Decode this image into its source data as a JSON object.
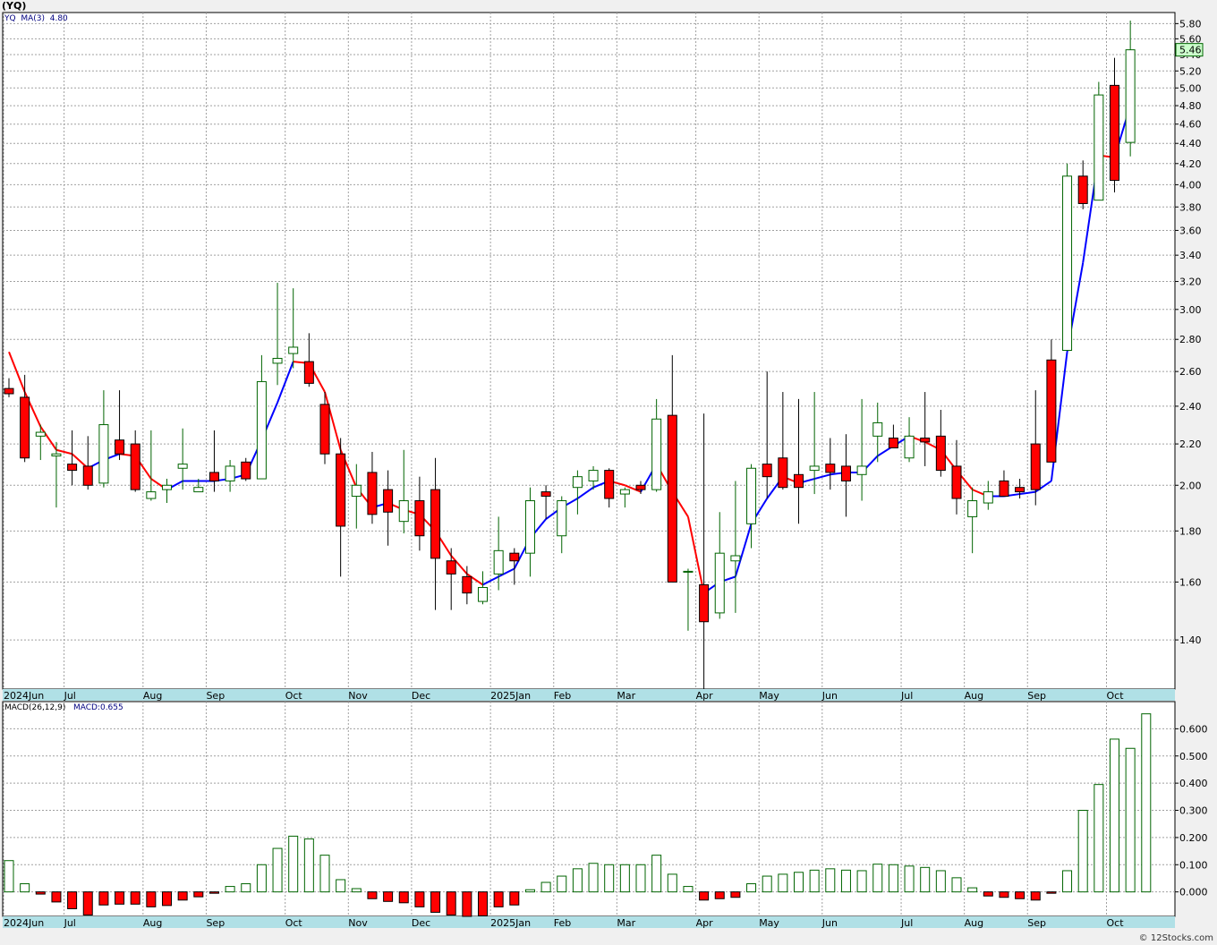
{
  "title": "(YQ)",
  "legend": {
    "ticker": "YQ",
    "ma_label": "MA(3)",
    "ma_value": "4.80",
    "macd_label": "MACD(26,12,9)",
    "macd_value": "MACD:0.655"
  },
  "watermark": "© 12Stocks.com",
  "colors": {
    "up": "#006400",
    "down": "#ff0000",
    "ma_up": "#0000ff",
    "ma_down": "#ff0000",
    "grid": "#a0a0a0",
    "axis_bar": "#b0e0e6",
    "price_tag": "#ccffcc"
  },
  "chart_data": [
    {
      "type": "candlestick",
      "scale": "log",
      "ylim": [
        1.25,
        5.95
      ],
      "yticks": [
        1.4,
        1.6,
        1.8,
        2.0,
        2.2,
        2.4,
        2.6,
        2.8,
        3.0,
        3.2,
        3.4,
        3.6,
        3.8,
        4.0,
        4.2,
        4.4,
        4.6,
        4.8,
        5.0,
        5.2,
        5.4,
        5.6,
        5.8
      ],
      "ytick_labels": [
        "1.40",
        "1.60",
        "1.80",
        "2.00",
        "2.20",
        "2.40",
        "2.60",
        "2.80",
        "3.00",
        "3.20",
        "3.40",
        "3.60",
        "3.80",
        "4.00",
        "4.20",
        "4.40",
        "4.60",
        "4.80",
        "5.00",
        "5.20",
        "5.40",
        "5.60",
        "5.80"
      ],
      "last_price": "5.46",
      "x_labels": [
        "2024Jun",
        "Jul",
        "Aug",
        "Sep",
        "Oct",
        "Nov",
        "Dec",
        "2025Jan",
        "Feb",
        "Mar",
        "Apr",
        "May",
        "Jun",
        "Jul",
        "Aug",
        "Sep",
        "Oct"
      ],
      "x_label_week": [
        0,
        4,
        9,
        13,
        18,
        22,
        26,
        31,
        35,
        39,
        44,
        48,
        52,
        57,
        61,
        65,
        70
      ],
      "weeks_ohlc": [
        [
          2.5,
          2.56,
          2.45,
          2.47
        ],
        [
          2.45,
          2.58,
          2.11,
          2.13
        ],
        [
          2.24,
          2.3,
          2.12,
          2.26
        ],
        [
          2.14,
          2.21,
          1.9,
          2.15
        ],
        [
          2.1,
          2.27,
          2.0,
          2.07
        ],
        [
          2.09,
          2.24,
          1.98,
          2.0
        ],
        [
          2.01,
          2.49,
          1.99,
          2.3
        ],
        [
          2.22,
          2.49,
          2.12,
          2.15
        ],
        [
          2.2,
          2.27,
          1.97,
          1.98
        ],
        [
          1.94,
          2.27,
          1.93,
          1.97
        ],
        [
          1.98,
          2.03,
          1.92,
          2.0
        ],
        [
          2.08,
          2.28,
          1.98,
          2.1
        ],
        [
          1.97,
          2.03,
          1.97,
          1.99
        ],
        [
          2.06,
          2.27,
          1.97,
          2.02
        ],
        [
          2.02,
          2.12,
          1.97,
          2.09
        ],
        [
          2.11,
          2.13,
          2.02,
          2.03
        ],
        [
          2.03,
          2.7,
          2.03,
          2.54
        ],
        [
          2.65,
          3.19,
          2.52,
          2.68
        ],
        [
          2.71,
          3.15,
          2.62,
          2.75
        ],
        [
          2.66,
          2.84,
          2.51,
          2.53
        ],
        [
          2.41,
          2.48,
          2.1,
          2.15
        ],
        [
          2.15,
          2.23,
          1.62,
          1.82
        ],
        [
          1.95,
          2.1,
          1.81,
          2.0
        ],
        [
          2.06,
          2.16,
          1.83,
          1.87
        ],
        [
          1.98,
          2.07,
          1.74,
          1.88
        ],
        [
          1.84,
          2.17,
          1.79,
          1.93
        ],
        [
          1.93,
          2.04,
          1.72,
          1.78
        ],
        [
          1.98,
          2.13,
          1.5,
          1.69
        ],
        [
          1.68,
          1.73,
          1.5,
          1.63
        ],
        [
          1.62,
          1.66,
          1.52,
          1.56
        ],
        [
          1.53,
          1.64,
          1.52,
          1.58
        ],
        [
          1.63,
          1.86,
          1.57,
          1.72
        ],
        [
          1.71,
          1.73,
          1.59,
          1.68
        ],
        [
          1.71,
          1.99,
          1.62,
          1.93
        ],
        [
          1.97,
          2.0,
          1.85,
          1.95
        ],
        [
          1.78,
          1.95,
          1.71,
          1.93
        ],
        [
          1.99,
          2.07,
          1.87,
          2.04
        ],
        [
          2.02,
          2.09,
          1.98,
          2.07
        ],
        [
          2.07,
          2.08,
          1.9,
          1.94
        ],
        [
          1.96,
          1.99,
          1.9,
          1.98
        ],
        [
          2.0,
          2.02,
          1.96,
          1.98
        ],
        [
          1.98,
          2.44,
          1.97,
          2.33
        ],
        [
          2.35,
          2.7,
          1.6,
          1.6
        ],
        [
          1.64,
          1.65,
          1.43,
          1.64
        ],
        [
          1.59,
          2.36,
          1.25,
          1.46
        ],
        [
          1.49,
          1.88,
          1.47,
          1.71
        ],
        [
          1.68,
          2.02,
          1.49,
          1.7
        ],
        [
          1.83,
          2.1,
          1.73,
          2.08
        ],
        [
          2.1,
          2.6,
          1.94,
          2.04
        ],
        [
          2.13,
          2.48,
          1.98,
          1.99
        ],
        [
          2.05,
          2.44,
          1.83,
          1.99
        ],
        [
          2.07,
          2.48,
          1.96,
          2.09
        ],
        [
          2.1,
          2.23,
          1.98,
          2.06
        ],
        [
          2.09,
          2.25,
          1.86,
          2.02
        ],
        [
          2.05,
          2.44,
          1.93,
          2.09
        ],
        [
          2.24,
          2.42,
          2.11,
          2.31
        ],
        [
          2.23,
          2.3,
          2.2,
          2.18
        ],
        [
          2.13,
          2.34,
          2.11,
          2.24
        ],
        [
          2.23,
          2.48,
          2.09,
          2.21
        ],
        [
          2.24,
          2.38,
          2.04,
          2.07
        ],
        [
          2.09,
          2.22,
          1.87,
          1.94
        ],
        [
          1.86,
          1.99,
          1.71,
          1.93
        ],
        [
          1.92,
          2.02,
          1.89,
          1.97
        ],
        [
          2.02,
          2.07,
          1.95,
          1.95
        ],
        [
          1.99,
          2.03,
          1.94,
          1.97
        ],
        [
          2.2,
          2.49,
          1.91,
          1.98
        ],
        [
          2.67,
          2.8,
          2.11,
          2.11
        ],
        [
          2.73,
          4.2,
          2.73,
          4.08
        ],
        [
          4.08,
          4.23,
          3.78,
          3.83
        ],
        [
          3.86,
          5.07,
          3.86,
          4.92
        ],
        [
          5.03,
          5.36,
          3.93,
          4.04
        ],
        [
          4.41,
          5.84,
          4.27,
          5.46
        ]
      ],
      "ma3": [
        2.72,
        2.48,
        2.29,
        2.17,
        2.15,
        2.08,
        2.12,
        2.15,
        2.14,
        2.03,
        1.98,
        2.02,
        2.02,
        2.02,
        2.03,
        2.05,
        2.22,
        2.42,
        2.66,
        2.65,
        2.48,
        2.17,
        1.99,
        1.9,
        1.92,
        1.89,
        1.87,
        1.8,
        1.7,
        1.63,
        1.59,
        1.62,
        1.65,
        1.77,
        1.85,
        1.9,
        1.94,
        1.99,
        2.02,
        2.0,
        1.97,
        2.1,
        1.97,
        1.86,
        1.56,
        1.6,
        1.62,
        1.83,
        1.94,
        2.04,
        2.01,
        2.03,
        2.05,
        2.06,
        2.06,
        2.14,
        2.19,
        2.24,
        2.21,
        2.17,
        2.07,
        1.98,
        1.95,
        1.95,
        1.96,
        1.97,
        2.02,
        2.72,
        3.34,
        4.28,
        4.26,
        4.8
      ]
    },
    {
      "type": "bar",
      "title": "MACD(26,12,9)",
      "ylim": [
        -0.09,
        0.7
      ],
      "yticks": [
        0.0,
        0.1,
        0.2,
        0.3,
        0.4,
        0.5,
        0.6
      ],
      "ytick_labels": [
        "0.000",
        "0.100",
        "0.200",
        "0.300",
        "0.400",
        "0.500",
        "0.600"
      ],
      "values": [
        0.115,
        0.03,
        -0.008,
        -0.037,
        -0.062,
        -0.085,
        -0.048,
        -0.045,
        -0.045,
        -0.055,
        -0.05,
        -0.03,
        -0.018,
        -0.005,
        0.02,
        0.03,
        0.1,
        0.16,
        0.205,
        0.195,
        0.135,
        0.045,
        0.012,
        -0.025,
        -0.035,
        -0.04,
        -0.055,
        -0.075,
        -0.085,
        -0.09,
        -0.088,
        -0.055,
        -0.048,
        0.008,
        0.035,
        0.058,
        0.085,
        0.105,
        0.1,
        0.1,
        0.1,
        0.135,
        0.065,
        0.02,
        -0.03,
        -0.025,
        -0.02,
        0.03,
        0.058,
        0.065,
        0.072,
        0.08,
        0.085,
        0.08,
        0.078,
        0.102,
        0.1,
        0.095,
        0.09,
        0.078,
        0.052,
        0.015,
        -0.015,
        -0.02,
        -0.025,
        -0.03,
        -0.005,
        0.078,
        0.3,
        0.395,
        0.562,
        0.528,
        0.655
      ]
    }
  ]
}
